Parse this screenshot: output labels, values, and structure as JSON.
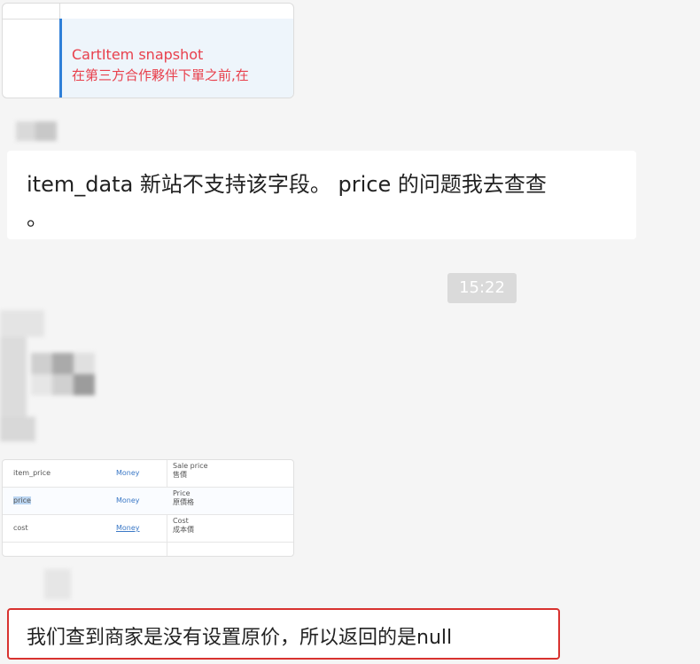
{
  "screenshot_top": {
    "line1": "CartItem snapshot",
    "line2": "在第三方合作夥伴下單之前,在"
  },
  "message1": {
    "line1": "item_data  新站不支持该字段。   price 的问题我去查查",
    "line2": "。"
  },
  "timestamp": "15:22",
  "field_table": {
    "rows": [
      {
        "field": "item_price",
        "type": "Money",
        "desc_en": "Sale price",
        "desc_zh": "售價"
      },
      {
        "field": "price",
        "type": "Money",
        "desc_en": "Price",
        "desc_zh": "原價格"
      },
      {
        "field": "cost",
        "type": "Money",
        "desc_en": "Cost",
        "desc_zh": "成本價"
      }
    ]
  },
  "message2": {
    "text": "我们查到商家是没有设置原价，所以返回的是null"
  },
  "colors": {
    "highlight_border": "#d8322f",
    "screenshot_red_text": "#e8404c",
    "link_blue": "#3a78c6"
  }
}
